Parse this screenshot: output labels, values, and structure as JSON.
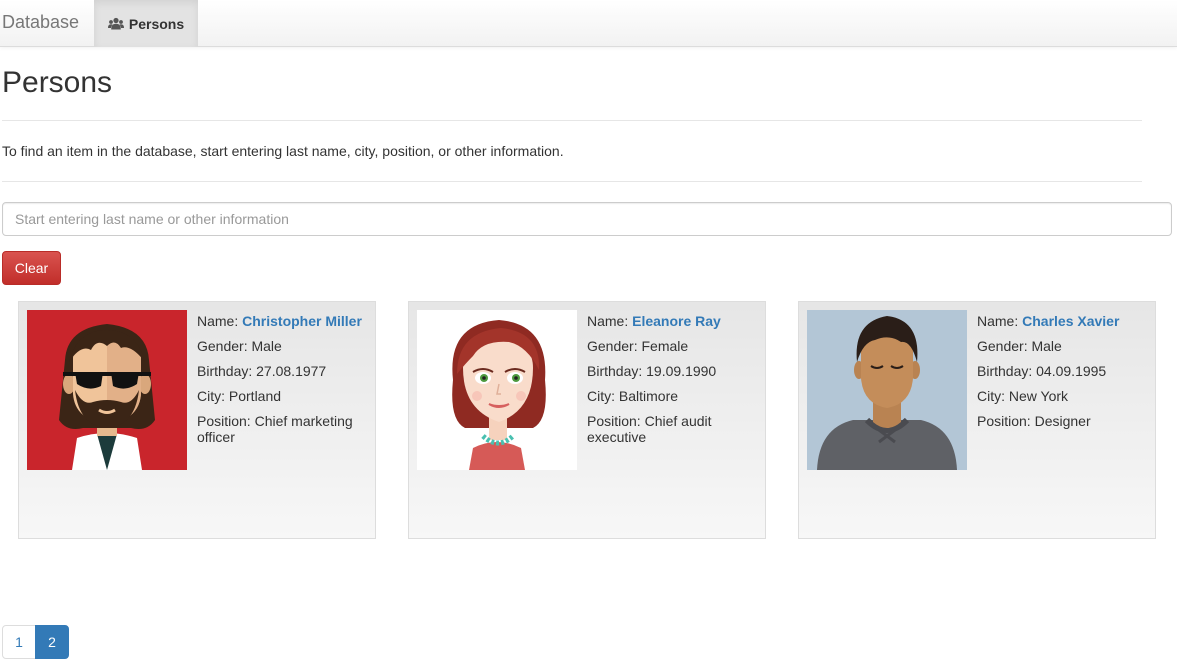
{
  "navbar": {
    "brand": "Database",
    "active_tab": {
      "label": "Persons",
      "icon": "users-icon"
    }
  },
  "page": {
    "title": "Persons",
    "hint": "To find an item in the database, start entering last name, city, position, or other information."
  },
  "search": {
    "value": "",
    "placeholder": "Start entering last name or other information"
  },
  "clear_button": {
    "label": "Clear"
  },
  "labels": {
    "name": "Name:",
    "gender": "Gender:",
    "birthday": "Birthday:",
    "city": "City:",
    "position": "Position:"
  },
  "persons": [
    {
      "name": "Christopher Miller",
      "gender": "Male",
      "birthday": "27.08.1977",
      "city": "Portland",
      "position": "Chief marketing officer",
      "avatar": "bearded-man-sunglasses-avatar"
    },
    {
      "name": "Eleanore Ray",
      "gender": "Female",
      "birthday": "19.09.1990",
      "city": "Baltimore",
      "position": "Chief audit executive",
      "avatar": "red-haired-woman-avatar"
    },
    {
      "name": "Charles Xavier",
      "gender": "Male",
      "birthday": "04.09.1995",
      "city": "New York",
      "position": "Designer",
      "avatar": "young-man-avatar"
    }
  ],
  "pagination": {
    "pages": [
      "1",
      "2"
    ],
    "current": "2"
  },
  "colors": {
    "link": "#337ab7",
    "danger": "#d9534f",
    "active_page": "#337ab7"
  }
}
